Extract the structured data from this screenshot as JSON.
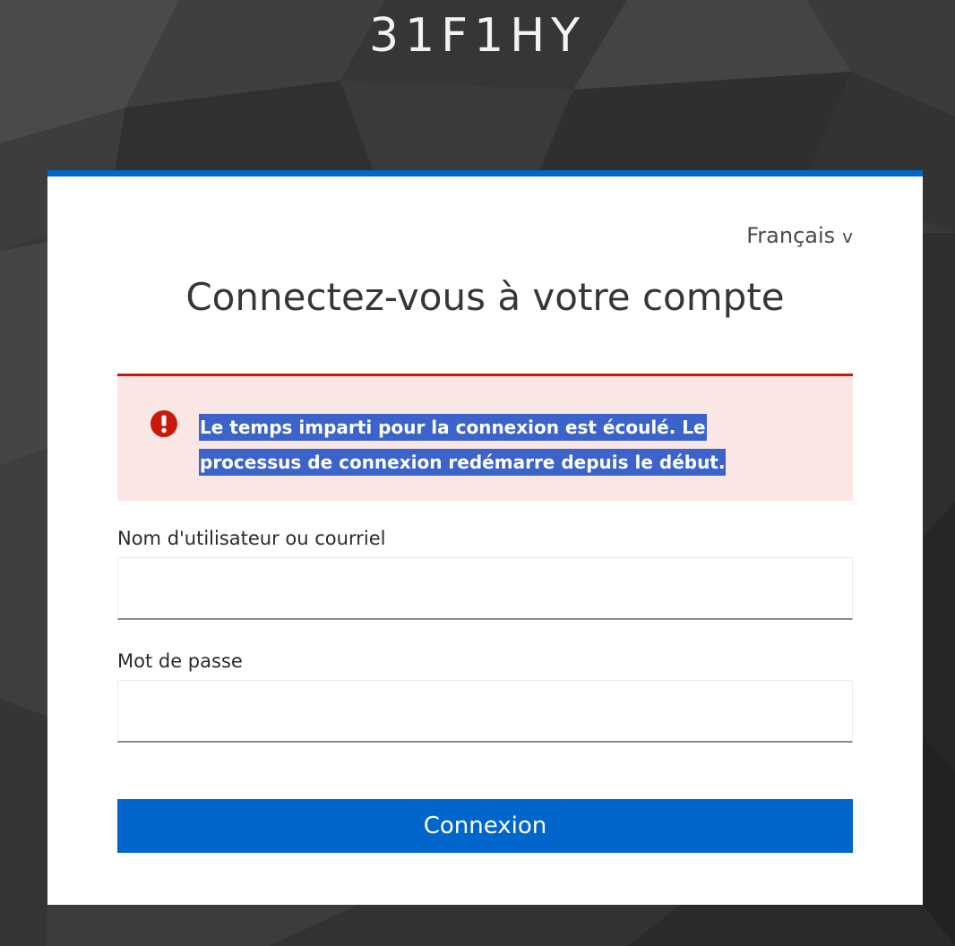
{
  "realm": {
    "title": "31F1HY"
  },
  "login": {
    "language": "Français",
    "language_chevron": "v",
    "heading": "Connectez-vous à votre compte",
    "alert": {
      "icon": "exclamation-circle-icon",
      "message": "Le temps imparti pour la connexion est écoulé. Le processus de connexion redémarre depuis le début.",
      "color": "#c9190b"
    },
    "username": {
      "label": "Nom d'utilisateur ou courriel",
      "value": ""
    },
    "password": {
      "label": "Mot de passe",
      "value": ""
    },
    "submit_label": "Connexion"
  },
  "colors": {
    "accent": "#0066cc",
    "alert_background": "#fae6e5",
    "alert_border": "#c9190b"
  }
}
